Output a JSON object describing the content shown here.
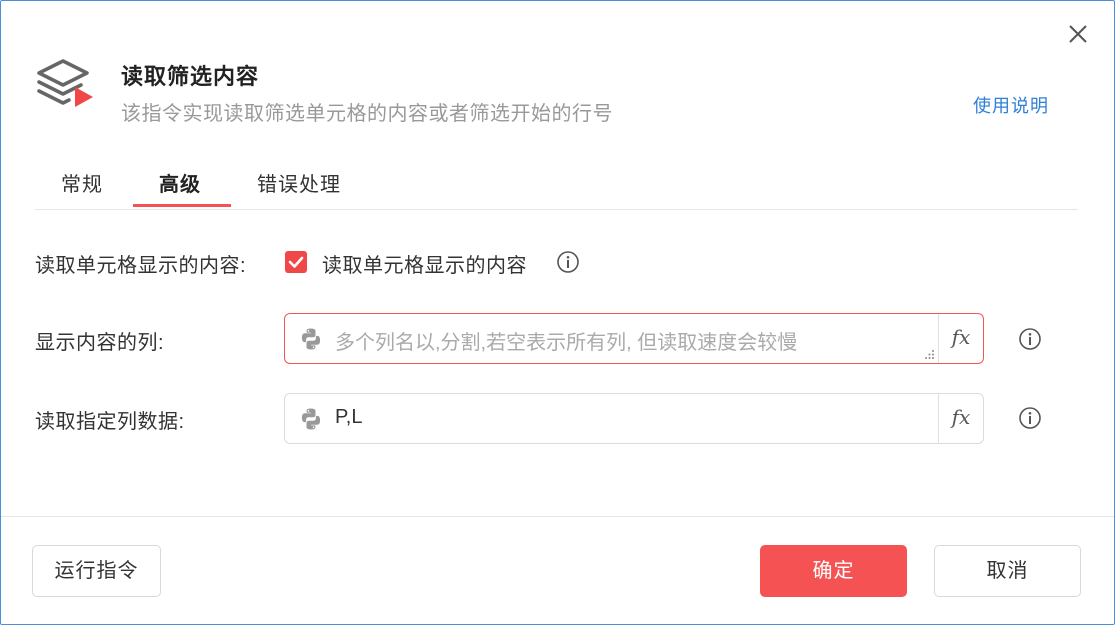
{
  "dialog": {
    "title": "读取筛选内容",
    "subtitle": "该指令实现读取筛选单元格的内容或者筛选开始的行号",
    "help_link": "使用说明",
    "close_icon": "close-icon",
    "header_icon": "layers-play-icon"
  },
  "tabs": [
    {
      "label": "常规",
      "active": false
    },
    {
      "label": "高级",
      "active": true
    },
    {
      "label": "错误处理",
      "active": false
    }
  ],
  "form": {
    "read_display": {
      "label": "读取单元格显示的内容:",
      "checkbox_label": "读取单元格显示的内容",
      "checked": true
    },
    "display_columns": {
      "label": "显示内容的列:",
      "value": "",
      "placeholder": "多个列名以,分割,若空表示所有列, 但读取速度会较慢",
      "fx": "fx"
    },
    "specified_columns": {
      "label": "读取指定列数据:",
      "value": "P,L",
      "fx": "fx"
    }
  },
  "footer": {
    "run_label": "运行指令",
    "ok_label": "确定",
    "cancel_label": "取消"
  },
  "colors": {
    "accent": "#f55353",
    "link": "#2f7fd6",
    "border": "#4a90d9"
  }
}
